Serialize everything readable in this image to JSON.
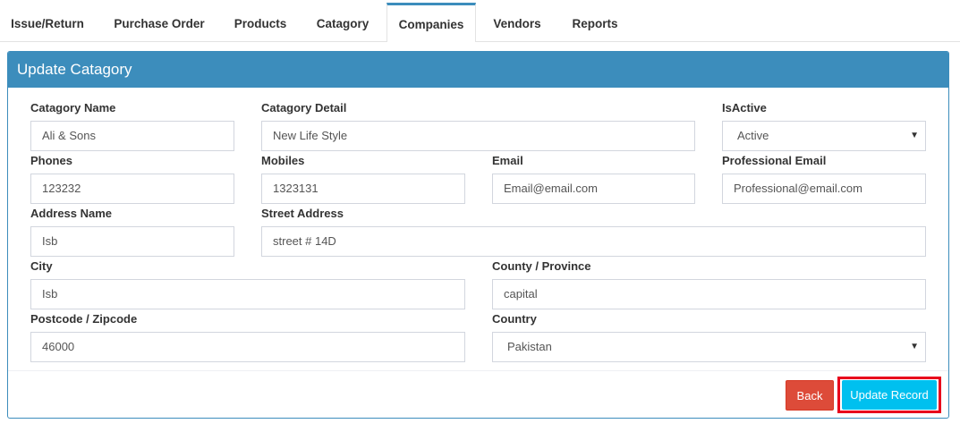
{
  "tabs": [
    {
      "label": "Issue/Return"
    },
    {
      "label": "Purchase Order"
    },
    {
      "label": "Products"
    },
    {
      "label": "Catagory"
    },
    {
      "label": "Companies"
    },
    {
      "label": "Vendors"
    },
    {
      "label": "Reports"
    }
  ],
  "active_tab": "Companies",
  "panel": {
    "title": "Update Catagory"
  },
  "form": {
    "category_name": {
      "label": "Catagory Name",
      "value": "Ali & Sons"
    },
    "category_detail": {
      "label": "Catagory Detail",
      "value": "New Life Style"
    },
    "is_active": {
      "label": "IsActive",
      "value": "Active"
    },
    "phones": {
      "label": "Phones",
      "value": "123232"
    },
    "mobiles": {
      "label": "Mobiles",
      "value": "1323131"
    },
    "email": {
      "label": "Email",
      "value": "Email@email.com"
    },
    "professional_email": {
      "label": "Professional Email",
      "value": "Professional@email.com"
    },
    "address_name": {
      "label": "Address Name",
      "value": "Isb"
    },
    "street_address": {
      "label": "Street Address",
      "value": "street # 14D"
    },
    "city": {
      "label": "City",
      "value": "Isb"
    },
    "county_province": {
      "label": "County / Province",
      "value": "capital"
    },
    "postcode": {
      "label": "Postcode / Zipcode",
      "value": "46000"
    },
    "country": {
      "label": "Country",
      "value": "Pakistan"
    }
  },
  "buttons": {
    "back": "Back",
    "update": "Update Record"
  },
  "colors": {
    "primary": "#3c8dbc",
    "danger": "#dd4b39",
    "info": "#00c0ef",
    "highlight": "#e8001c"
  },
  "icons": {
    "select_caret": "caret-down-icon"
  }
}
